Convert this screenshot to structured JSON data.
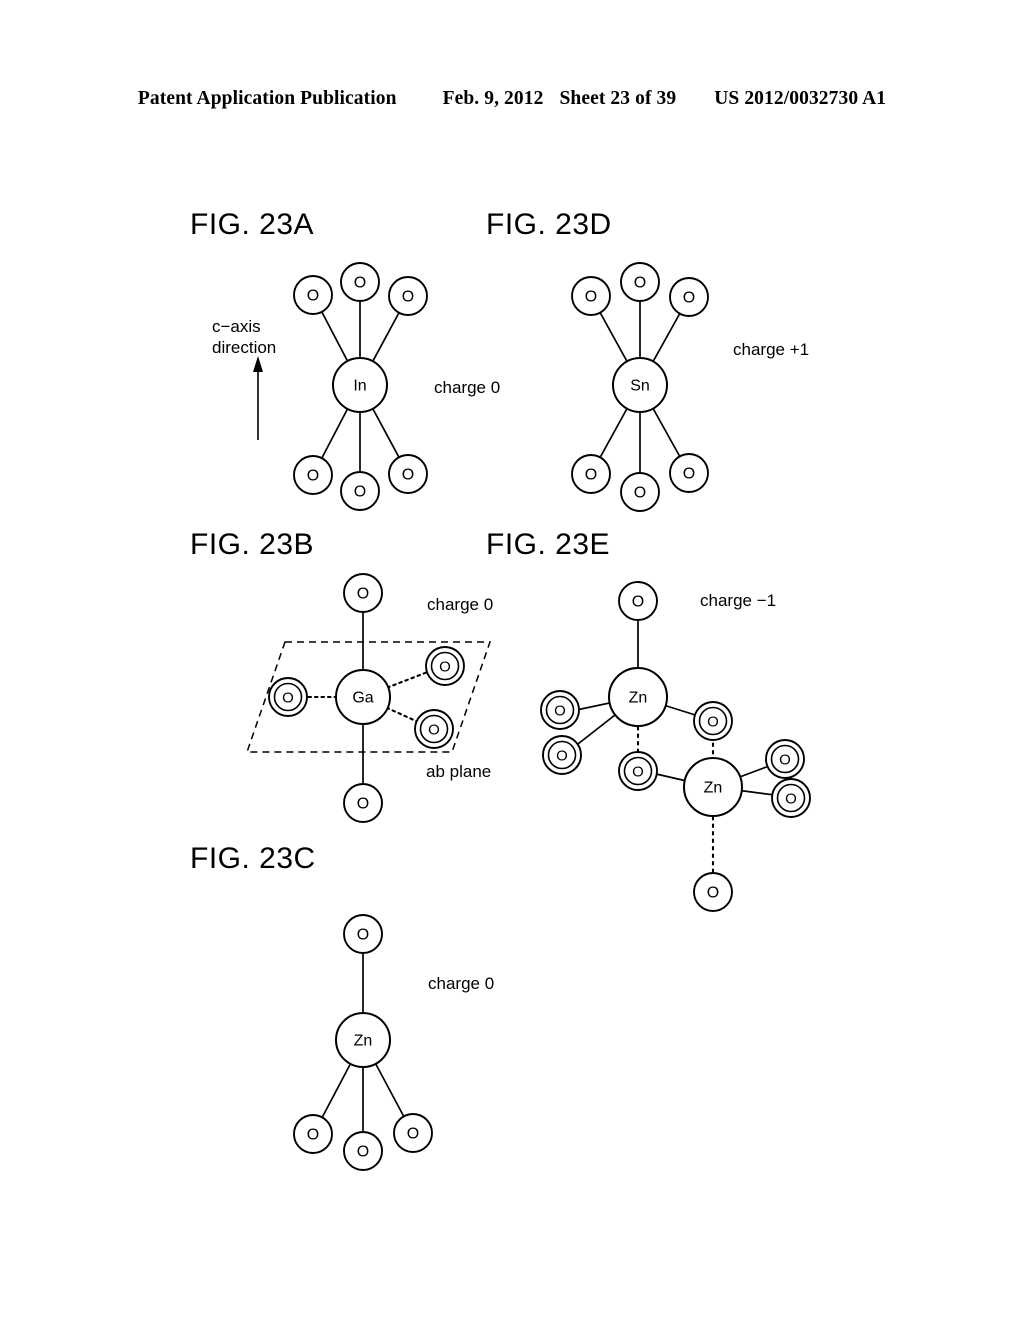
{
  "header": {
    "publication": "Patent Application Publication",
    "date": "Feb. 9, 2012",
    "sheet": "Sheet 23 of 39",
    "number": "US 2012/0032730 A1"
  },
  "figures": [
    {
      "id": "fig23a",
      "label": "FIG. 23A",
      "center_atom": "In",
      "charge": "charge 0",
      "axis_note_line1": "c−axis",
      "axis_note_line2": "direction",
      "ligands": [
        {
          "symbol": "O",
          "style": "single",
          "bond": "solid"
        },
        {
          "symbol": "O",
          "style": "single",
          "bond": "solid"
        },
        {
          "symbol": "O",
          "style": "single",
          "bond": "solid"
        },
        {
          "symbol": "O",
          "style": "single",
          "bond": "solid"
        },
        {
          "symbol": "O",
          "style": "single",
          "bond": "solid"
        },
        {
          "symbol": "O",
          "style": "single",
          "bond": "solid"
        }
      ]
    },
    {
      "id": "fig23b",
      "label": "FIG. 23B",
      "center_atom": "Ga",
      "charge": "charge 0",
      "plane_note": "ab plane",
      "ligands": [
        {
          "symbol": "O",
          "style": "single",
          "bond": "solid"
        },
        {
          "symbol": "O",
          "style": "single",
          "bond": "solid"
        },
        {
          "symbol": "O",
          "style": "double",
          "bond": "dotted"
        },
        {
          "symbol": "O",
          "style": "double",
          "bond": "dotted"
        },
        {
          "symbol": "O",
          "style": "double",
          "bond": "dotted"
        }
      ]
    },
    {
      "id": "fig23c",
      "label": "FIG. 23C",
      "center_atom": "Zn",
      "charge": "charge 0",
      "ligands": [
        {
          "symbol": "O",
          "style": "single",
          "bond": "solid"
        },
        {
          "symbol": "O",
          "style": "single",
          "bond": "solid"
        },
        {
          "symbol": "O",
          "style": "single",
          "bond": "solid"
        },
        {
          "symbol": "O",
          "style": "single",
          "bond": "solid"
        }
      ]
    },
    {
      "id": "fig23d",
      "label": "FIG. 23D",
      "center_atom": "Sn",
      "charge": "charge +1",
      "ligands": [
        {
          "symbol": "O",
          "style": "single",
          "bond": "solid"
        },
        {
          "symbol": "O",
          "style": "single",
          "bond": "solid"
        },
        {
          "symbol": "O",
          "style": "single",
          "bond": "solid"
        },
        {
          "symbol": "O",
          "style": "single",
          "bond": "solid"
        },
        {
          "symbol": "O",
          "style": "single",
          "bond": "solid"
        },
        {
          "symbol": "O",
          "style": "single",
          "bond": "solid"
        }
      ]
    },
    {
      "id": "fig23e",
      "label": "FIG. 23E",
      "center_atom_1": "Zn",
      "center_atom_2": "Zn",
      "charge": "charge −1",
      "ligands": [
        {
          "symbol": "O",
          "style": "single",
          "bond": "solid"
        },
        {
          "symbol": "O",
          "style": "double",
          "bond": "solid"
        },
        {
          "symbol": "O",
          "style": "double",
          "bond": "solid"
        },
        {
          "symbol": "O",
          "style": "double",
          "bond": "solid"
        },
        {
          "symbol": "O",
          "style": "double",
          "bond": "dotted"
        },
        {
          "symbol": "O",
          "style": "double",
          "bond": "dotted"
        },
        {
          "symbol": "O",
          "style": "double",
          "bond": "solid"
        },
        {
          "symbol": "O",
          "style": "double",
          "bond": "solid"
        },
        {
          "symbol": "O",
          "style": "single",
          "bond": "dotted"
        }
      ]
    }
  ],
  "atom_symbols": {
    "oxygen": "O",
    "indium": "In",
    "gallium": "Ga",
    "zinc": "Zn",
    "tin": "Sn"
  },
  "colors": {
    "ink": "#000000",
    "paper": "#ffffff"
  }
}
